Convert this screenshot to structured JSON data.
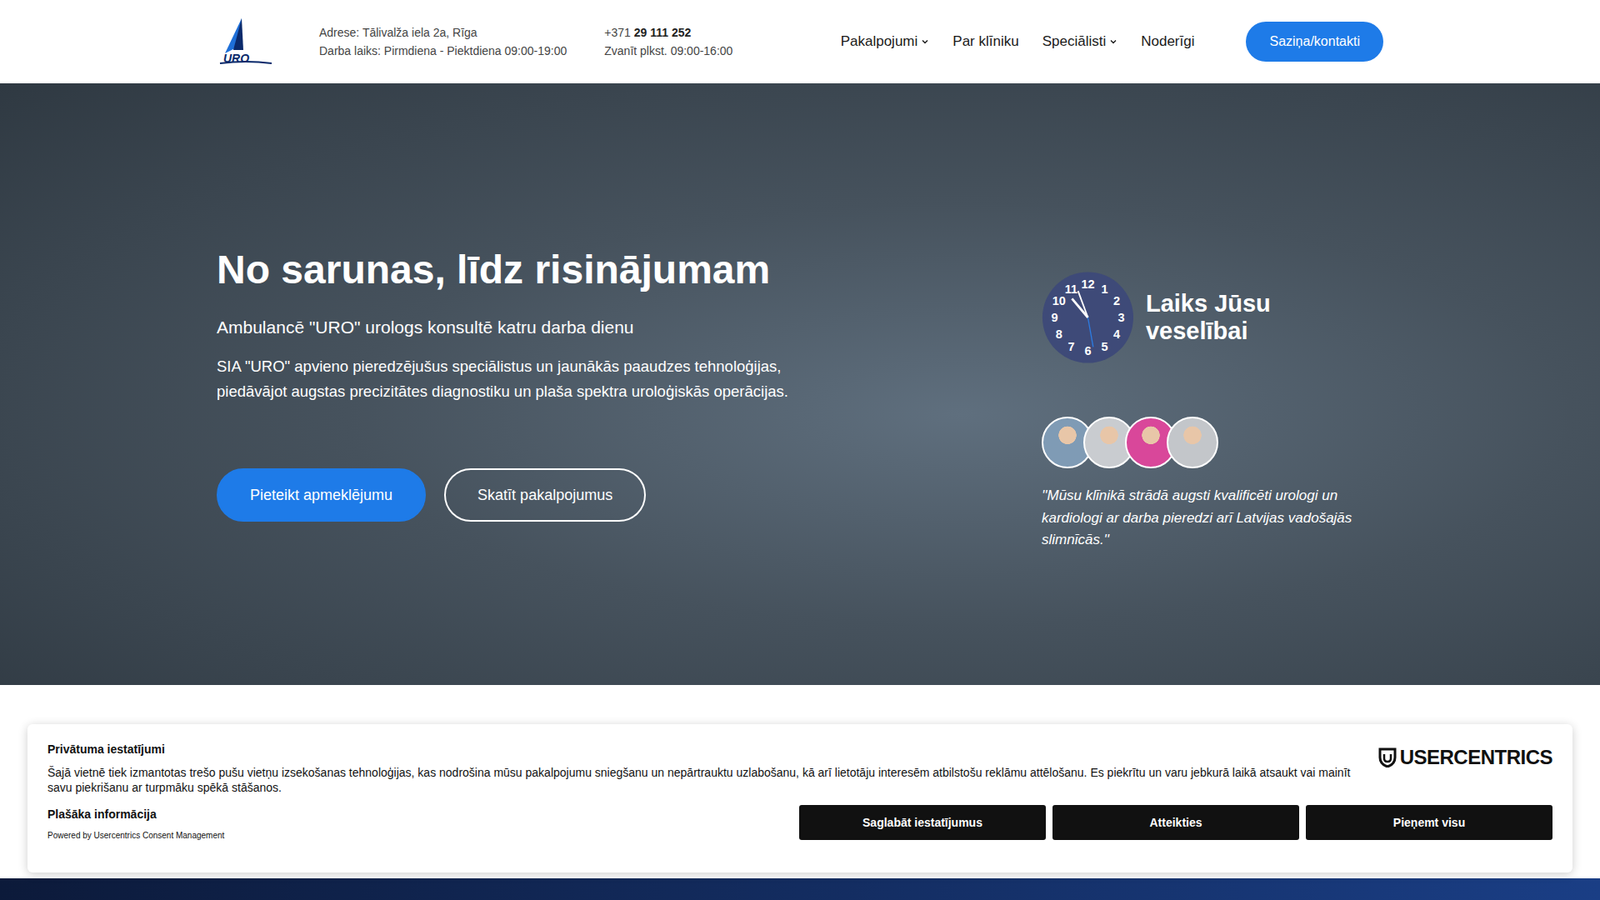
{
  "header": {
    "logo": "URO",
    "address": "Adrese: Tālivalža iela 2a, Rīga",
    "hours": "Darba laiks: Pirmdiena - Piektdiena 09:00-19:00",
    "phone_prefix": "+371",
    "phone_number": "29 111 252",
    "call_hours": "Zvanīt plkst. 09:00-16:00",
    "nav": [
      {
        "label": "Pakalpojumi",
        "dropdown": true
      },
      {
        "label": "Par klīniku",
        "dropdown": false
      },
      {
        "label": "Speciālisti",
        "dropdown": true
      },
      {
        "label": "Noderīgi",
        "dropdown": false
      }
    ],
    "contact_button": "Saziņa/kontakti"
  },
  "hero": {
    "title": "No sarunas, līdz risinājumam",
    "subtitle": "Ambulancē \"URO\" urologs konsultē katru darba dienu",
    "description": "SIA \"URO\" apvieno pieredzējušus speciālistus un jaunākās paaudzes tehnoloģijas, piedāvājot augstas precizitātes diagnostiku un plaša spektra uroloģiskās operācijas.",
    "primary_button": "Pieteikt apmeklējumu",
    "secondary_button": "Skatīt pakalpojumus",
    "clock_numbers": [
      "12",
      "1",
      "2",
      "3",
      "4",
      "5",
      "6",
      "7",
      "8",
      "9",
      "10",
      "11"
    ],
    "tagline": "Laiks Jūsu veselībai",
    "avatars": [
      {
        "color": "#7f9bb5"
      },
      {
        "color": "#c9ccd0"
      },
      {
        "color": "#d9479a"
      },
      {
        "color": "#c3c6ca"
      }
    ],
    "quote": "''Mūsu klīnikā strādā augsti kvalificēti urologi un kardiologi ar darba pieredzi arī Latvijas vadošajās slimnīcās.''"
  },
  "cookie_banner": {
    "title": "Privātuma iestatījumi",
    "text": "Šajā vietnē tiek izmantotas trešo pušu vietņu izsekošanas tehnoloģijas, kas nodrošina mūsu pakalpojumu sniegšanu un nepārtrauktu uzlabošanu, kā arī lietotāju interesēm atbilstošu reklāmu attēlošanu. Es piekrītu un varu jebkurā laikā atsaukt vai mainīt savu piekrišanu ar turpmāku spēkā stāšanos.",
    "more_info": "Plašāka informācija",
    "powered_by": "Powered by Usercentrics Consent Management",
    "brand": "USERCENTRICS",
    "buttons": [
      "Saglabāt iestatījumus",
      "Atteikties",
      "Pieņemt visu"
    ]
  }
}
